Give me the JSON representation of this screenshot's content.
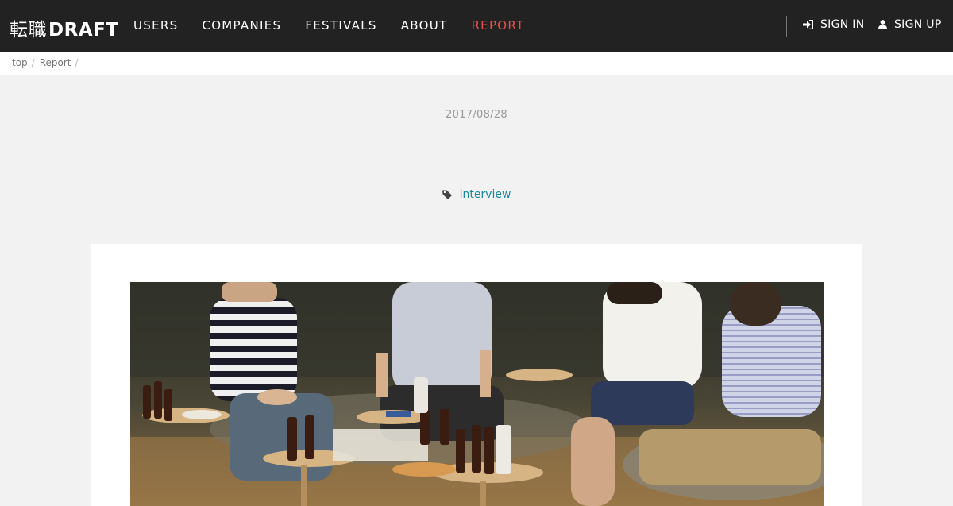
{
  "header": {
    "logo_jp": "転職",
    "logo_en": "DRAFT",
    "nav": [
      {
        "label": "USERS"
      },
      {
        "label": "COMPANIES"
      },
      {
        "label": "FESTIVALS"
      },
      {
        "label": "ABOUT"
      },
      {
        "label": "REPORT",
        "active": true
      }
    ],
    "sign_in": "SIGN IN",
    "sign_up": "SIGN UP",
    "accent_color": "#e8544b"
  },
  "breadcrumb": {
    "items": [
      "top",
      "Report"
    ],
    "separator": "/"
  },
  "article": {
    "date": "2017/08/28",
    "tag_icon": "tag-icon",
    "tag": "interview",
    "hero_image": "photo of four men seated around small round tables with beer bottles and pizza"
  }
}
